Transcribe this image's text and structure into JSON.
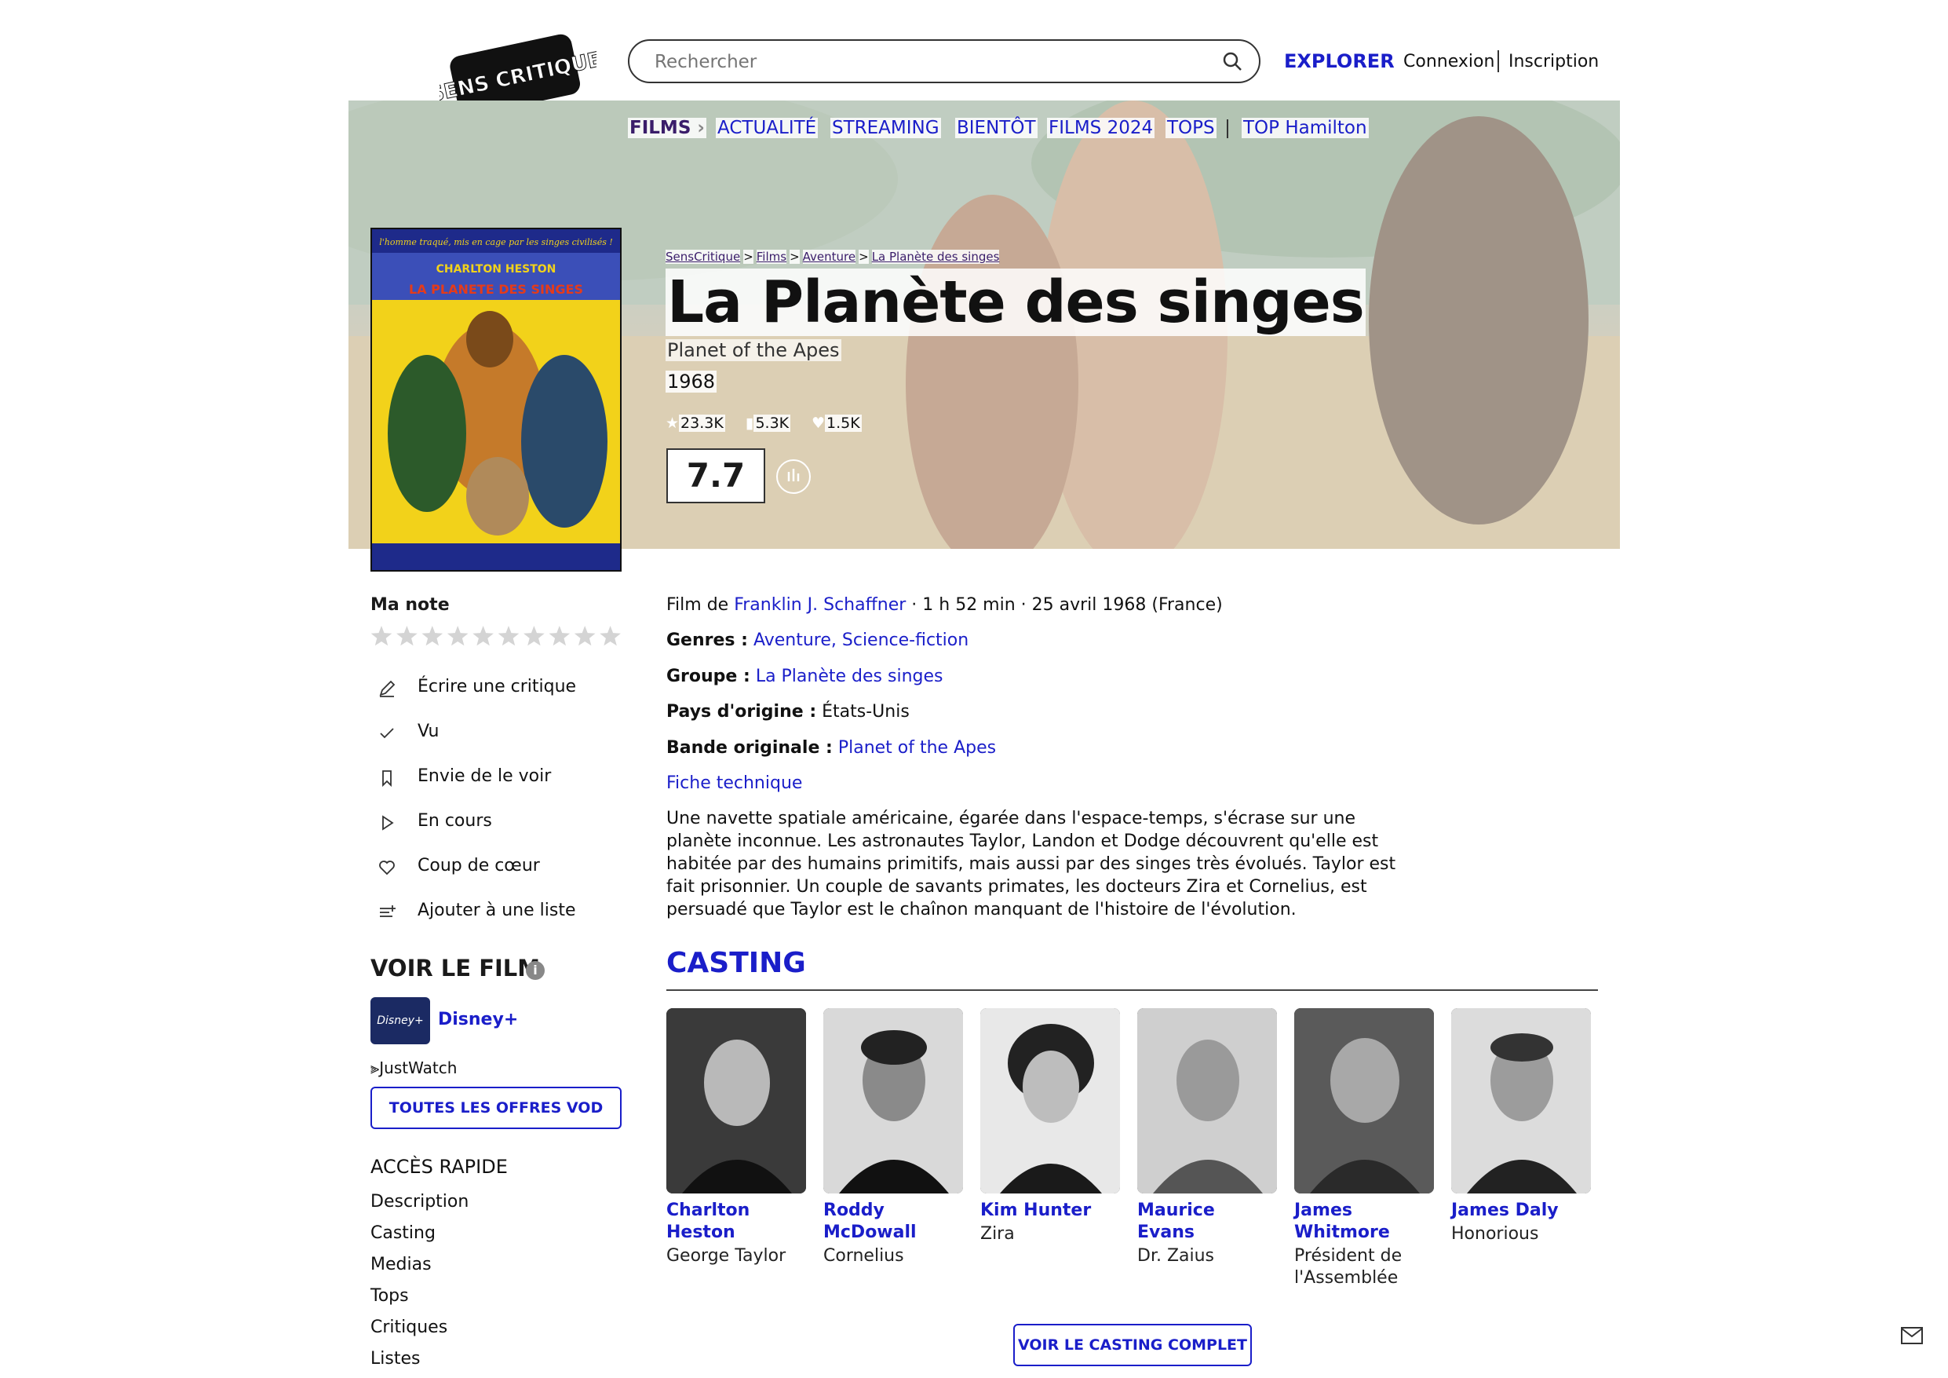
{
  "header": {
    "logo_text": "SENS CRITIQUE",
    "search_placeholder": "Rechercher",
    "explorer": "EXPLORER",
    "connexion": "Connexion",
    "inscription": "Inscription"
  },
  "subnav": {
    "films": "FILMS",
    "items": [
      "ACTUALITÉ",
      "STREAMING",
      "BIENTÔT",
      "FILMS 2024",
      "TOPS"
    ],
    "extra": "TOP Hamilton"
  },
  "breadcrumb": [
    "SensCritique",
    "Films",
    "Aventure",
    "La Planète des singes"
  ],
  "movie": {
    "title": "La Planète des singes",
    "original_title": "Planet of the Apes",
    "year": "1968",
    "ratings_count": "23.3K",
    "wishlist_count": "5.3K",
    "likes_count": "1.5K",
    "score": "7.7",
    "poster_tagline": "l'homme traqué, mis en cage par les singes civilisés !",
    "poster_star": "CHARLTON HESTON",
    "poster_title": "LA PLANETE DES SINGES"
  },
  "my_rating": {
    "label": "Ma note",
    "stars": 10
  },
  "actions": [
    {
      "label": "Écrire une critique",
      "icon": "pencil-icon"
    },
    {
      "label": "Vu",
      "icon": "check-icon"
    },
    {
      "label": "Envie de le voir",
      "icon": "bookmark-icon"
    },
    {
      "label": "En cours",
      "icon": "play-icon"
    },
    {
      "label": "Coup de cœur",
      "icon": "heart-icon"
    },
    {
      "label": "Ajouter à une liste",
      "icon": "list-add-icon"
    }
  ],
  "watch": {
    "title": "VOIR LE FILM",
    "info_icon": "i",
    "provider_logo": "Disney+",
    "provider_name": "Disney+",
    "justwatch": "JustWatch",
    "vod_button": "TOUTES LES OFFRES VOD"
  },
  "quick_access": {
    "title": "ACCÈS RAPIDE",
    "items": [
      "Description",
      "Casting",
      "Medias",
      "Tops",
      "Critiques",
      "Listes"
    ]
  },
  "details": {
    "film_de": "Film de",
    "director": "Franklin J. Schaffner",
    "meta": "· 1 h 52 min · 25 avril 1968 (France)",
    "genres_label": "Genres :",
    "genres": "Aventure, Science-fiction",
    "groupe_label": "Groupe :",
    "groupe": "La Planète des singes",
    "pays_label": "Pays d'origine :",
    "pays": "États-Unis",
    "bo_label": "Bande originale :",
    "bo": "Planet of the Apes",
    "fiche": "Fiche technique"
  },
  "synopsis": "Une navette spatiale américaine, égarée dans l'espace-temps, s'écrase sur une planète inconnue. Les astronautes Taylor, Landon et Dodge découvrent qu'elle est habitée par des humains primitifs, mais aussi par des singes très évolués. Taylor est fait prisonnier. Un couple de savants primates, les docteurs Zira et Cornelius, est persuadé que Taylor est le chaînon manquant de l'histoire de l'évolution.",
  "casting": {
    "title": "CASTING",
    "cast": [
      {
        "name": "Charlton Heston",
        "role": "George Taylor"
      },
      {
        "name": "Roddy McDowall",
        "role": "Cornelius"
      },
      {
        "name": "Kim Hunter",
        "role": "Zira"
      },
      {
        "name": "Maurice Evans",
        "role": "Dr. Zaius"
      },
      {
        "name": "James Whitmore",
        "role": "Président de l'Assemblée"
      },
      {
        "name": "James Daly",
        "role": "Honorious"
      }
    ],
    "full_button": "VOIR LE CASTING COMPLET"
  },
  "colors": {
    "accent": "#1a1ec9",
    "films_nav": "#3a1d6a"
  }
}
